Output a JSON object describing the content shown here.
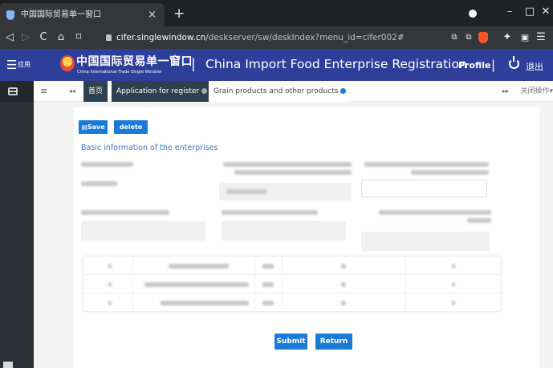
{
  "browser": {
    "tab_title": "中国国际贸易单一窗口",
    "tab_close": "×",
    "new_tab": "+",
    "url_host": "cifer.singlewindow.cn",
    "url_path": "/deskserver/sw/deskIndex?menu_id=cifer002#",
    "win_min": "–",
    "win_max": "□",
    "win_close": "✕",
    "nav_back": "◁",
    "nav_forward": "▷",
    "nav_reload": "C",
    "nav_home": "⌂",
    "nav_bookmark": "⌑"
  },
  "header": {
    "menu_icon": "☰",
    "menu_label": "应用",
    "logo_cn": "中国国际贸易单一窗口",
    "logo_en": "China International Trade Single Window",
    "separator": "|",
    "title": "China Import Food Enterprise Registration",
    "profile": "Profile",
    "logout": "退出"
  },
  "tabs": {
    "menu_icon": "≡",
    "back_icon": "◂◂",
    "items": [
      {
        "label": "首页"
      },
      {
        "label": "Application for register"
      },
      {
        "label": "Grain products and other products"
      }
    ],
    "forward_icon": "▸▸",
    "close_ops": "关闭操作▾"
  },
  "form": {
    "save_label": "Save",
    "delete_label": "delete",
    "section_title": "Basic information of the enterprises",
    "submit_label": "Submit",
    "return_label": "Return"
  },
  "colors": {
    "header_bg": "#2e3f9a",
    "accent": "#1a7bd6",
    "sidebar_bg": "#2d3036"
  }
}
